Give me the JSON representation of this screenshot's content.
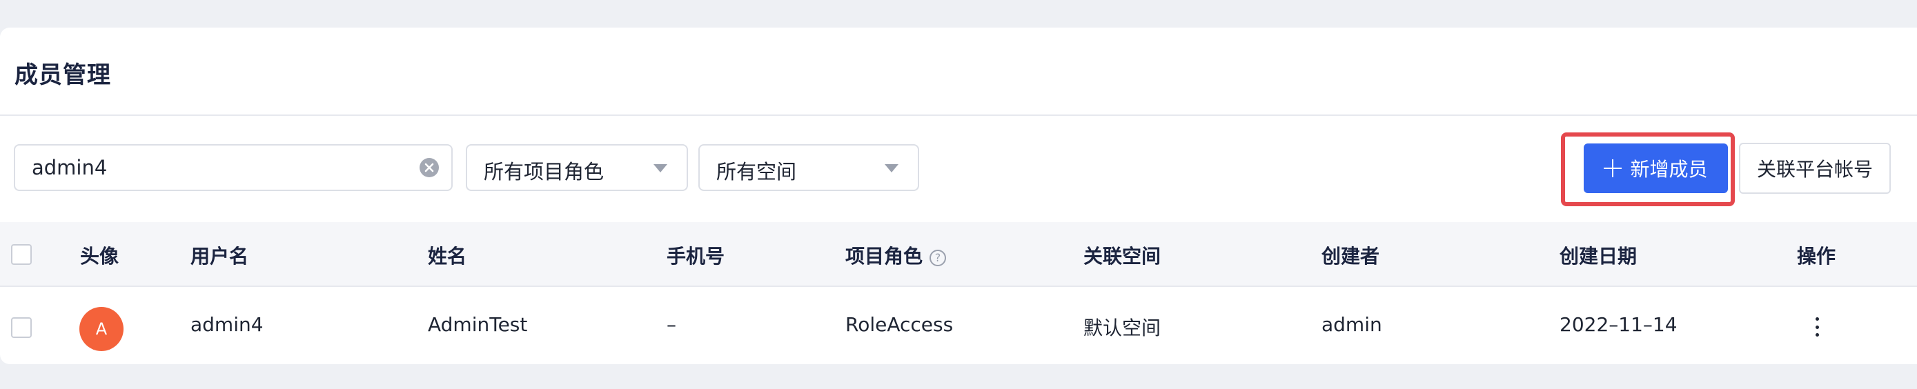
{
  "page": {
    "title": "成员管理"
  },
  "filters": {
    "search_value": "admin4",
    "role_select": "所有项目角色",
    "space_select": "所有空间"
  },
  "actions": {
    "add_member": "新增成员",
    "link_account": "关联平台帐号"
  },
  "table": {
    "headers": {
      "avatar": "头像",
      "username": "用户名",
      "name": "姓名",
      "phone": "手机号",
      "role": "项目角色",
      "space": "关联空间",
      "creator": "创建者",
      "created": "创建日期",
      "ops": "操作"
    },
    "rows": [
      {
        "avatar_letter": "A",
        "username": "admin4",
        "name": "AdminTest",
        "phone": "–",
        "role": "RoleAccess",
        "space": "默认空间",
        "creator": "admin",
        "created": "2022–11–14"
      }
    ]
  },
  "colors": {
    "primary": "#3366f0",
    "highlight": "#e5484d",
    "avatar": "#f4623a"
  }
}
